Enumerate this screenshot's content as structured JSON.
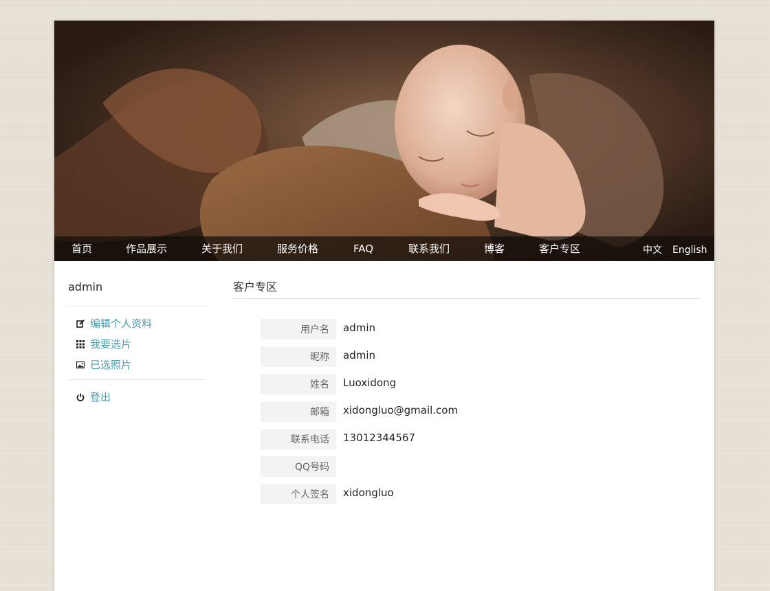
{
  "banner": {
    "image": "sleeping-newborn-photo"
  },
  "nav": {
    "items": [
      "首页",
      "作品展示",
      "关于我们",
      "服务价格",
      "FAQ",
      "联系我们",
      "博客",
      "客户专区"
    ],
    "lang": [
      "中文",
      "English"
    ]
  },
  "sidebar": {
    "username": "admin",
    "items": [
      {
        "label": "编辑个人资料",
        "icon": "edit-icon"
      },
      {
        "label": "我要选片",
        "icon": "grid-icon"
      },
      {
        "label": "已选照片",
        "icon": "picture-icon"
      }
    ],
    "logout": {
      "label": "登出",
      "icon": "power-icon"
    }
  },
  "main": {
    "title": "客户专区",
    "fields": [
      {
        "label": "用户名",
        "value": "admin"
      },
      {
        "label": "昵称",
        "value": "admin"
      },
      {
        "label": "姓名",
        "value": "Luoxidong"
      },
      {
        "label": "邮箱",
        "value": "xidongluo@gmail.com"
      },
      {
        "label": "联系电话",
        "value": "13012344567"
      },
      {
        "label": "QQ号码",
        "value": ""
      },
      {
        "label": "个人签名",
        "value": "xidongluo"
      }
    ]
  },
  "colors": {
    "link": "#4a9aa8",
    "nav_bg": "#140e0a"
  }
}
